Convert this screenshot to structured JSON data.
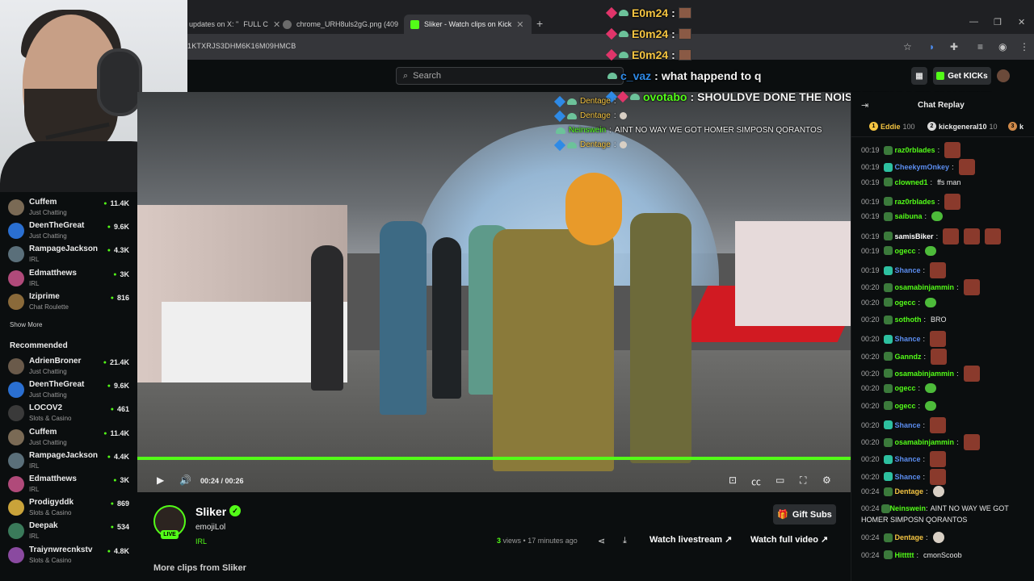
{
  "browser": {
    "tabs": [
      {
        "label": "updates on X: \"",
        "label2": "FULL C"
      },
      {
        "label": "chrome_URH8uls2gG.png (409"
      },
      {
        "label": "Sliker - Watch clips on Kick"
      }
    ],
    "url": "1KTXRJS3DHM6K16M09HMCB"
  },
  "header": {
    "search_placeholder": "Search",
    "get_kicks": "Get KICKs"
  },
  "overlay_chat": [
    {
      "user": "E0m24",
      "sep": ":"
    },
    {
      "user": "E0m24",
      "sep": ":"
    },
    {
      "user": "E0m24",
      "sep": ":"
    },
    {
      "user": "c_vaz",
      "sep": ":",
      "text": "what happend to q"
    },
    {
      "user": "ovotabo",
      "sep": ":",
      "text": "SHOULDVE DONE THE NOISE THEY DO TO MONKEYS"
    }
  ],
  "video_overlay_chat": [
    {
      "user": "Dentage",
      "sep": ":"
    },
    {
      "user": "Dentage",
      "sep": ":"
    },
    {
      "user": "Neinswein",
      "sep": ":",
      "text": "AINT NO WAY WE GOT HOMER SIMPOSN QORANTOS"
    },
    {
      "user": "Dentage",
      "sep": ":"
    }
  ],
  "sidebar": {
    "following": [
      {
        "name": "Cuffem",
        "category": "Just Chatting",
        "viewers": "11.4K",
        "color": "#7a6a55"
      },
      {
        "name": "DeenTheGreat",
        "category": "Just Chatting",
        "viewers": "9.6K",
        "color": "#2a6fd1"
      },
      {
        "name": "RampageJackson",
        "category": "IRL",
        "viewers": "4.3K",
        "color": "#5a6f7a"
      },
      {
        "name": "Edmatthews",
        "category": "IRL",
        "viewers": "3K",
        "color": "#b04a7a"
      },
      {
        "name": "Iziprime",
        "category": "Chat Roulette",
        "viewers": "816",
        "color": "#8a6a3a"
      }
    ],
    "show_more": "Show More",
    "recommended_title": "Recommended",
    "recommended": [
      {
        "name": "AdrienBroner",
        "category": "Just Chatting",
        "viewers": "21.4K",
        "color": "#6a5a4a"
      },
      {
        "name": "DeenTheGreat",
        "category": "Just Chatting",
        "viewers": "9.6K",
        "color": "#2a6fd1"
      },
      {
        "name": "LOCOV2",
        "category": "Slots & Casino",
        "viewers": "461",
        "color": "#3a3a3a"
      },
      {
        "name": "Cuffem",
        "category": "Just Chatting",
        "viewers": "11.4K",
        "color": "#7a6a55"
      },
      {
        "name": "RampageJackson",
        "category": "IRL",
        "viewers": "4.4K",
        "color": "#5a6f7a"
      },
      {
        "name": "Edmatthews",
        "category": "IRL",
        "viewers": "3K",
        "color": "#b04a7a"
      },
      {
        "name": "Prodigyddk",
        "category": "Slots & Casino",
        "viewers": "869",
        "color": "#c9a33a"
      },
      {
        "name": "Deepak",
        "category": "IRL",
        "viewers": "534",
        "color": "#3a7a5a"
      },
      {
        "name": "Traiynwrecnkstv",
        "category": "Slots & Casino",
        "viewers": "4.8K",
        "color": "#8a4aa0"
      }
    ]
  },
  "player": {
    "time": "00:24 / 00:26",
    "progress": 1.0
  },
  "clip_info": {
    "streamer": "Sliker",
    "live": "LIVE",
    "title": "emojiLol",
    "category": "IRL",
    "gift_subs": "Gift Subs",
    "views_count": "3",
    "views_rest": "views • 17 minutes ago",
    "watch_livestream": "Watch livestream",
    "watch_full_video": "Watch full video",
    "more_clips": "More clips from Sliker"
  },
  "chat": {
    "title": "Chat Replay",
    "pinned": [
      {
        "rank": "1",
        "name": "Eddie",
        "points": "100",
        "color": "#f5c542"
      },
      {
        "rank": "2",
        "name": "kickgeneral10",
        "points": "10",
        "color": "#d9d9d9"
      },
      {
        "rank": "3",
        "name": "k",
        "points": "",
        "color": "#d08a4a"
      }
    ],
    "messages": [
      {
        "time": "00:19",
        "user": "raz0rblades",
        "color": "#53fc18",
        "text": ""
      },
      {
        "time": "00:19",
        "user": "CheekymOnkey",
        "color": "#5b8def",
        "text": ""
      },
      {
        "time": "00:19",
        "user": "clowned1",
        "color": "#53fc18",
        "text": "ffs man"
      },
      {
        "time": "00:19",
        "user": "raz0rblades",
        "color": "#53fc18",
        "text": ""
      },
      {
        "time": "00:19",
        "user": "saibuna",
        "color": "#53fc18",
        "text": ""
      },
      {
        "time": "00:19",
        "user": "samisBiker",
        "color": "#ffffff",
        "text": ""
      },
      {
        "time": "00:19",
        "user": "ogecc",
        "color": "#53fc18",
        "text": ""
      },
      {
        "time": "00:19",
        "user": "Shance",
        "color": "#5b8def",
        "text": ""
      },
      {
        "time": "00:20",
        "user": "osamabinjammin",
        "color": "#53fc18",
        "text": ""
      },
      {
        "time": "00:20",
        "user": "ogecc",
        "color": "#53fc18",
        "text": ""
      },
      {
        "time": "00:20",
        "user": "sothoth",
        "color": "#53fc18",
        "text": "BRO"
      },
      {
        "time": "00:20",
        "user": "Shance",
        "color": "#5b8def",
        "text": ""
      },
      {
        "time": "00:20",
        "user": "Ganndz",
        "color": "#53fc18",
        "text": ""
      },
      {
        "time": "00:20",
        "user": "osamabinjammin",
        "color": "#53fc18",
        "text": ""
      },
      {
        "time": "00:20",
        "user": "ogecc",
        "color": "#53fc18",
        "text": ""
      },
      {
        "time": "00:20",
        "user": "ogecc",
        "color": "#53fc18",
        "text": ""
      },
      {
        "time": "00:20",
        "user": "Shance",
        "color": "#5b8def",
        "text": ""
      },
      {
        "time": "00:20",
        "user": "osamabinjammin",
        "color": "#53fc18",
        "text": ""
      },
      {
        "time": "00:20",
        "user": "Shance",
        "color": "#5b8def",
        "text": ""
      },
      {
        "time": "00:20",
        "user": "Shance",
        "color": "#5b8def",
        "text": ""
      },
      {
        "time": "00:24",
        "user": "Dentage",
        "color": "#f5c542",
        "text": ""
      },
      {
        "time": "00:24",
        "user": "Neinswein",
        "color": "#53fc18",
        "text": "AINT NO WAY WE GOT HOMER SIMPOSN QORANTOS"
      },
      {
        "time": "00:24",
        "user": "Dentage",
        "color": "#f5c542",
        "text": ""
      },
      {
        "time": "00:24",
        "user": "Hittttt",
        "color": "#53fc18",
        "text": "cmonScoob"
      }
    ]
  },
  "colors": {
    "accent": "#53fc18",
    "background": "#0b0e0f"
  }
}
